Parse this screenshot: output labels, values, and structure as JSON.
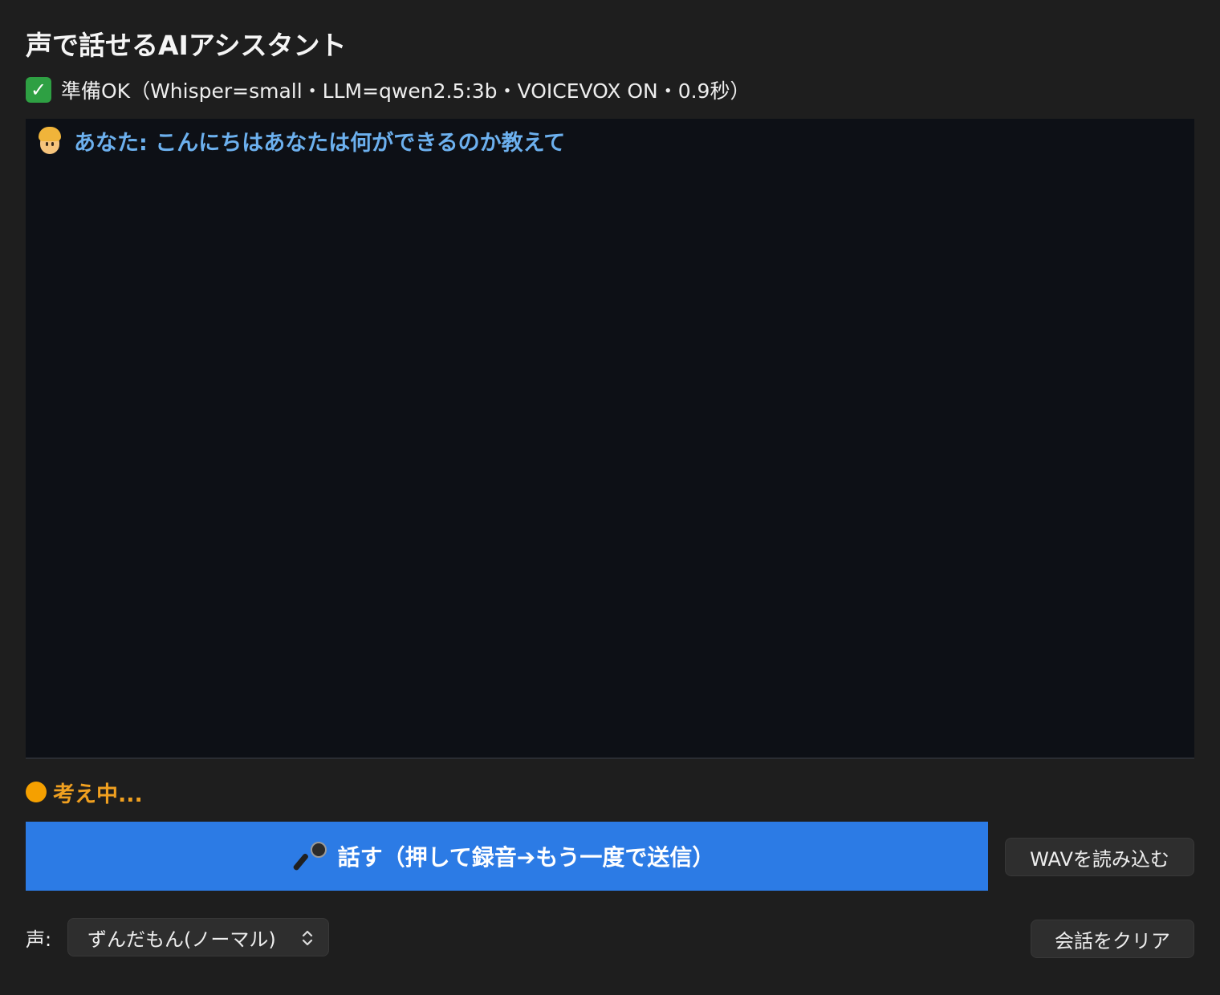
{
  "app": {
    "title": "声で話せるAIアシスタント"
  },
  "status": {
    "icon": "check-mark-icon",
    "text": "準備OK（Whisper=small・LLM=qwen2.5:3b・VOICEVOX ON・0.9秒）"
  },
  "chat": {
    "messages": [
      {
        "icon": "person-blond-hair-icon",
        "text": "あなた: こんにちはあなたは何ができるのか教えて",
        "color": "#6cb0ee"
      }
    ]
  },
  "thinking": {
    "icon": "orange-circle-icon",
    "text": "考え中...",
    "color": "#f0a020"
  },
  "controls": {
    "talk_icon": "microphone-icon",
    "talk_label": "話す（押して録音➔もう一度で送信）",
    "wav_label": "WAVを読み込む",
    "voice_label": "声:",
    "voice_selected": "ずんだもん(ノーマル)",
    "clear_label": "会話をクリア"
  },
  "colors": {
    "background": "#1e1e1e",
    "chat_background": "#0d1016",
    "accent": "#2c7be5"
  }
}
